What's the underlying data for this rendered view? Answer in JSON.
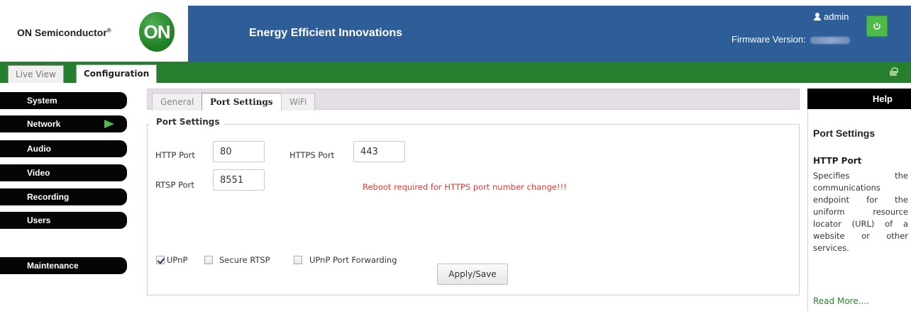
{
  "header": {
    "brand": "ON Semiconductor",
    "brand_mark": "®",
    "logo_text": "ON",
    "tagline": "Energy Efficient Innovations",
    "user": "admin",
    "firmware_label": "Firmware Version:"
  },
  "main_tabs": [
    {
      "label": "Live View",
      "active": false
    },
    {
      "label": "Configuration",
      "active": true
    }
  ],
  "sidebar": {
    "items": [
      {
        "label": "System",
        "active": false
      },
      {
        "label": "Network",
        "active": true
      },
      {
        "label": "Audio",
        "active": false
      },
      {
        "label": "Video",
        "active": false
      },
      {
        "label": "Recording",
        "active": false
      },
      {
        "label": "Users",
        "active": false
      },
      {
        "label": "Maintenance",
        "active": false
      }
    ]
  },
  "sub_tabs": [
    {
      "label": "General",
      "active": false
    },
    {
      "label": "Port Settings",
      "active": true
    },
    {
      "label": "WiFi",
      "active": false
    }
  ],
  "port_settings": {
    "legend": "Port Settings",
    "http_label": "HTTP Port",
    "http_value": "80",
    "https_label": "HTTPS Port",
    "https_value": "443",
    "rtsp_label": "RTSP Port",
    "rtsp_value": "8551",
    "warning": "Reboot required for HTTPS port number change!!!",
    "upnp_label": "UPnP",
    "upnp_checked": true,
    "secure_rtsp_label": "Secure RTSP",
    "secure_rtsp_checked": false,
    "upnp_forward_label": "UPnP Port Forwarding",
    "upnp_forward_checked": false
  },
  "apply_label": "Apply/Save",
  "help": {
    "heading": "Help",
    "title": "Port Settings",
    "subtitle": "HTTP Port",
    "text": "Specifies the communications endpoint for the uniform resource locator (URL) of a website or other services.",
    "link": "Read More...."
  },
  "colors": {
    "banner": "#2e5e98",
    "tabbar": "#267f2e",
    "accent_green": "#4cbb47",
    "warning": "#e53935",
    "sidebar": "#050505"
  }
}
